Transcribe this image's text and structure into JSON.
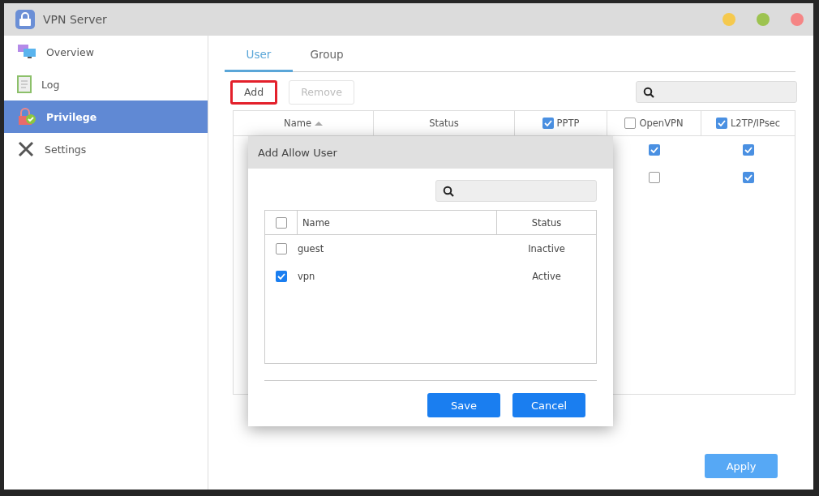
{
  "window": {
    "title": "VPN Server",
    "controls": [
      {
        "color": "#f5c94e"
      },
      {
        "color": "#9dc350"
      },
      {
        "color": "#f58585"
      }
    ]
  },
  "sidebar": {
    "items": [
      {
        "label": "Overview",
        "kind": "overview",
        "selected": false
      },
      {
        "label": "Log",
        "kind": "log",
        "selected": false
      },
      {
        "label": "Privilege",
        "kind": "privilege",
        "selected": true
      },
      {
        "label": "Settings",
        "kind": "settings",
        "selected": false
      }
    ]
  },
  "tabs": [
    {
      "label": "User",
      "selected": true
    },
    {
      "label": "Group",
      "selected": false
    }
  ],
  "toolbar": {
    "buttons": [
      {
        "label": "Add",
        "disabled": false,
        "highlighted": true
      },
      {
        "label": "Remove",
        "disabled": true,
        "highlighted": false
      }
    ]
  },
  "table": {
    "columns": [
      {
        "label": "Name",
        "sorted": true
      },
      {
        "label": "Status",
        "sorted": false
      },
      {
        "label": "PPTP",
        "checked": true
      },
      {
        "label": "OpenVPN",
        "checked": false
      },
      {
        "label": "L2TP/IPsec",
        "checked": true
      }
    ],
    "rows": [
      {
        "openvpn": true,
        "l2tp": true
      },
      {
        "openvpn": false,
        "l2tp": true
      }
    ]
  },
  "dialog": {
    "title": "Add Allow User",
    "select_all": {
      "checked": false
    },
    "columns": [
      "Name",
      "Status"
    ],
    "rows": [
      {
        "name": "guest",
        "status": "Inactive",
        "checked": false
      },
      {
        "name": "vpn",
        "status": "Active",
        "checked": true
      }
    ],
    "buttons": [
      "Save",
      "Cancel"
    ]
  },
  "apply_button": "Apply"
}
